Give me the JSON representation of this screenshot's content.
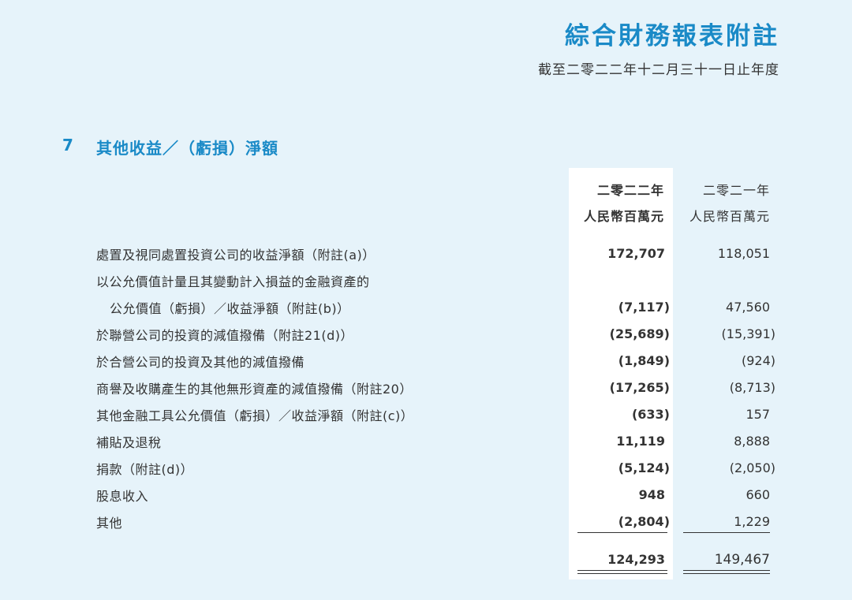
{
  "header": {
    "title": "綜合財務報表附註",
    "subtitle": "截至二零二二年十二月三十一日止年度"
  },
  "section": {
    "number": "7",
    "title": "其他收益／（虧損）淨額"
  },
  "columns": {
    "current": {
      "year": "二零二二年",
      "unit": "人民幣百萬元"
    },
    "previous": {
      "year": "二零二一年",
      "unit": "人民幣百萬元"
    }
  },
  "rows": [
    {
      "label": "處置及視同處置投資公司的收益淨額（附註(a)）",
      "current": "172,707",
      "previous": "118,051"
    },
    {
      "label": "以公允價值計量且其變動計入損益的金融資產的",
      "current": "",
      "previous": ""
    },
    {
      "label": "公允價值（虧損）／收益淨額（附註(b)）",
      "current": "(7,117)",
      "previous": "47,560"
    },
    {
      "label": "於聯營公司的投資的減值撥備（附註21(d)）",
      "current": "(25,689)",
      "previous": "(15,391)"
    },
    {
      "label": "於合營公司的投資及其他的減值撥備",
      "current": "(1,849)",
      "previous": "(924)"
    },
    {
      "label": "商譽及收購產生的其他無形資產的減值撥備（附註20）",
      "current": "(17,265)",
      "previous": "(8,713)"
    },
    {
      "label": "其他金融工具公允價值（虧損）／收益淨額（附註(c)）",
      "current": "(633)",
      "previous": "157"
    },
    {
      "label": "補貼及退稅",
      "current": "11,119",
      "previous": "8,888"
    },
    {
      "label": "捐款（附註(d)）",
      "current": "(5,124)",
      "previous": "(2,050)"
    },
    {
      "label": "股息收入",
      "current": "948",
      "previous": "660"
    },
    {
      "label": "其他",
      "current": "(2,804)",
      "previous": "1,229"
    }
  ],
  "totals": {
    "current": "124,293",
    "previous": "149,467"
  }
}
